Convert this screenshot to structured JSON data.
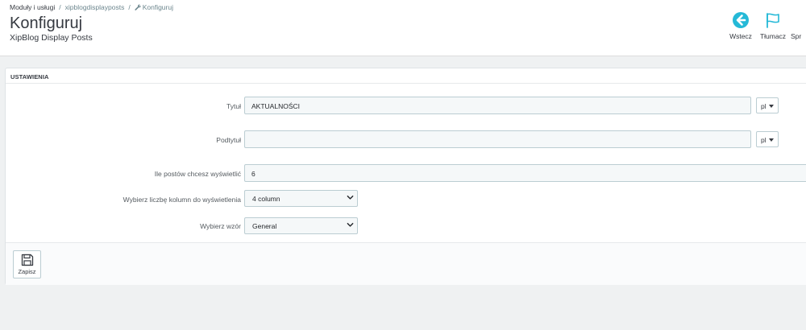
{
  "breadcrumb": {
    "items": [
      "Moduły i usługi",
      "xipblogdisplayposts",
      "Konfiguruj"
    ],
    "separator": "/"
  },
  "header": {
    "title": "Konfiguruj",
    "subtitle": "XipBlog Display Posts"
  },
  "toolbar": {
    "back_label": "Wstecz",
    "back_icon": "back-arrow-circle-icon",
    "translate_label": "Tłumacz",
    "translate_icon": "flag-icon",
    "more_label": "Spr"
  },
  "panel": {
    "heading": "USTAWIENIA",
    "fields": {
      "title": {
        "label": "Tytuł",
        "value": "AKTUALNOŚCI",
        "lang": "pl"
      },
      "subtitle": {
        "label": "Podtytuł",
        "value": "",
        "lang": "pl"
      },
      "posts_count": {
        "label": "Ile postów chcesz wyświetlić",
        "value": "6"
      },
      "columns": {
        "label": "Wybierz liczbę kolumn do wyświetlenia",
        "selected": "4 column"
      },
      "pattern": {
        "label": "Wybierz wzór",
        "selected": "General"
      }
    },
    "save_label": "Zapisz"
  },
  "colors": {
    "accent": "#25b9d7",
    "background": "#eff1f2",
    "input_bg": "#f5f8f9",
    "input_border": "#bbcdd2"
  }
}
